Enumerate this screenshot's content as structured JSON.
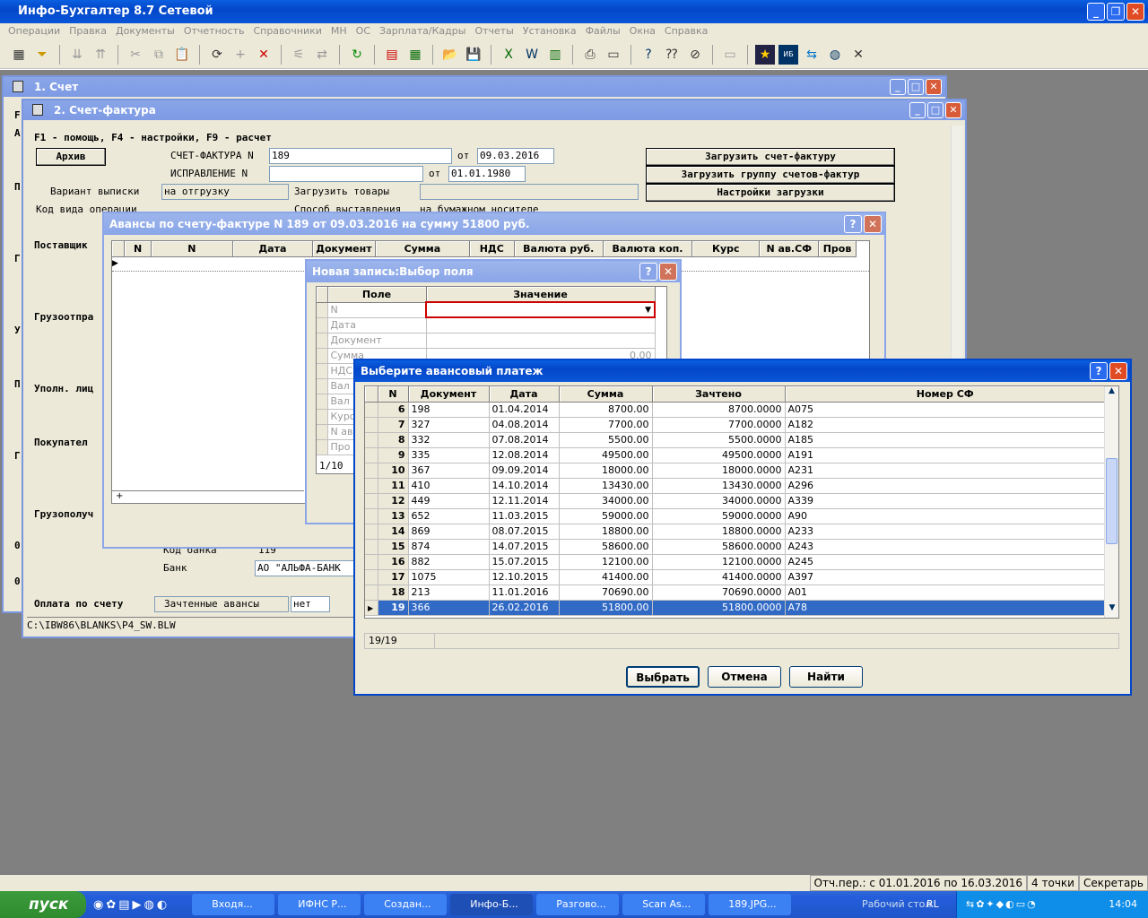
{
  "app": {
    "title": "Инфо-Бухгалтер 8.7 Сетевой"
  },
  "menu": [
    "Операции",
    "Правка",
    "Документы",
    "Отчетность",
    "Справочники",
    "МН",
    "ОС",
    "Зарплата/Кадры",
    "Отчеты",
    "Установка",
    "Файлы",
    "Окна",
    "Справка"
  ],
  "win1": {
    "title": "1. Счет"
  },
  "win2": {
    "title": "2. Счет-фактура",
    "help": "F1 - помощь, F4 - настройки, F9 - расчет",
    "archive": "Архив",
    "invoice_label": "СЧЕТ-ФАКТУРА N",
    "invoice_no": "189",
    "from": "от",
    "invoice_date": "09.03.2016",
    "correction_label": "ИСПРАВЛЕНИЕ  N",
    "correction_no": "",
    "correction_date": "01.01.1980",
    "btn_load": "Загрузить счет-фактуру",
    "btn_load_group": "Загрузить группу счетов-фактур",
    "btn_settings": "Настройки загрузки",
    "variant_label": "Вариант выписки",
    "variant_value": "на отгрузку",
    "load_goods": "Загрузить товары",
    "opcode_label": "Код вида операции",
    "method_label": "Способ выставления",
    "method_value": "на бумажном носителе",
    "supplier": "Поставщик",
    "shipper": "Грузоотпра",
    "authorized": "Уполн. лиц",
    "buyer": "Покупател",
    "consignee": "Грузополуч",
    "bank_code_label": "Код банка",
    "bank_code": "119",
    "bank_label": "Банк",
    "bank_value": "АО \"АЛЬФА-БАНК",
    "payment_label": "Оплата по счету",
    "offset_label": "Зачтенные авансы",
    "offset_value": "нет",
    "path": "C:\\IBW86\\BLANKS\\P4_SW.BLW",
    "side_letters": [
      "F",
      "А",
      "П",
      "Г",
      "У",
      "П",
      "Г",
      "0",
      "0"
    ]
  },
  "advances": {
    "title": "Авансы по счету-фактуре N 189 от 09.03.2016 на сумму 51800 руб.",
    "columns": [
      "N",
      "N",
      "Дата",
      "Документ",
      "Сумма",
      "НДС",
      "Валюта руб.",
      "Валюта коп.",
      "Курс",
      "N ав.СФ",
      "Пров"
    ],
    "plus": "+"
  },
  "newrec": {
    "title": "Новая запись:Выбор поля",
    "col_field": "Поле",
    "col_value": "Значение",
    "fields": [
      "N",
      "Дата",
      "Документ",
      "Сумма",
      "НДС",
      "Вал",
      "Вал",
      "Курс",
      "N ав",
      "Про"
    ],
    "summa_value": "0.00",
    "counter": "1/10"
  },
  "select": {
    "title": "Выберите авансовый платеж",
    "columns": [
      "N",
      "Документ",
      "Дата",
      "Сумма",
      "Зачтено",
      "Номер СФ"
    ],
    "rows": [
      [
        "6",
        "198",
        "01.04.2014",
        "8700.00",
        "8700.0000",
        "А075"
      ],
      [
        "7",
        "327",
        "04.08.2014",
        "7700.00",
        "7700.0000",
        "А182"
      ],
      [
        "8",
        "332",
        "07.08.2014",
        "5500.00",
        "5500.0000",
        "А185"
      ],
      [
        "9",
        "335",
        "12.08.2014",
        "49500.00",
        "49500.0000",
        "А191"
      ],
      [
        "10",
        "367",
        "09.09.2014",
        "18000.00",
        "18000.0000",
        "А231"
      ],
      [
        "11",
        "410",
        "14.10.2014",
        "13430.00",
        "13430.0000",
        "А296"
      ],
      [
        "12",
        "449",
        "12.11.2014",
        "34000.00",
        "34000.0000",
        "А339"
      ],
      [
        "13",
        "652",
        "11.03.2015",
        "59000.00",
        "59000.0000",
        "А90"
      ],
      [
        "14",
        "869",
        "08.07.2015",
        "18800.00",
        "18800.0000",
        "А233"
      ],
      [
        "15",
        "874",
        "14.07.2015",
        "58600.00",
        "58600.0000",
        "А243"
      ],
      [
        "16",
        "882",
        "15.07.2015",
        "12100.00",
        "12100.0000",
        "А245"
      ],
      [
        "17",
        "1075",
        "12.10.2015",
        "41400.00",
        "41400.0000",
        "А397"
      ],
      [
        "18",
        "213",
        "11.01.2016",
        "70690.00",
        "70690.0000",
        "А01"
      ],
      [
        "19",
        "366",
        "26.02.2016",
        "51800.00",
        "51800.0000",
        "А78"
      ]
    ],
    "counter": "19/19",
    "btn_select": "Выбрать",
    "btn_cancel": "Отмена",
    "btn_find": "Найти"
  },
  "status": {
    "period": "Отч.пер.: с 01.01.2016 по 16.03.2016",
    "points": "4 точки",
    "role": "Секретарь"
  },
  "taskbar": {
    "start": "пуск",
    "tasks": [
      "Входя...",
      "ИФНС Р...",
      "Создан...",
      "Инфо-Б...",
      "Разгово...",
      "Scan As...",
      "189.JPG..."
    ],
    "desktop": "Рабочий стол",
    "lang": "RL",
    "clock": "14:04"
  }
}
